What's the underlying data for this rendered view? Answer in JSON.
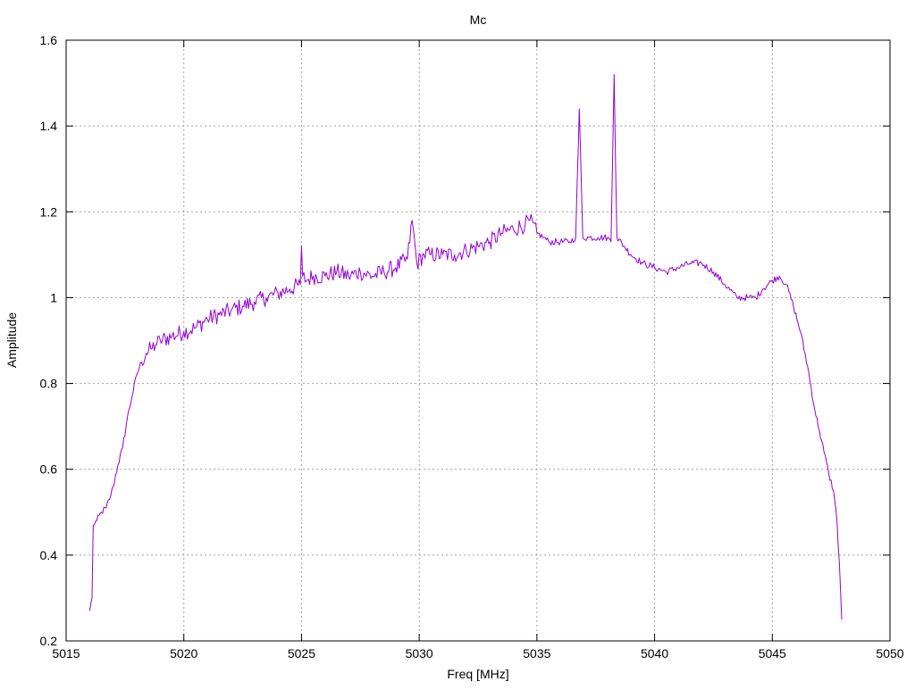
{
  "chart_data": {
    "type": "line",
    "title": "Mc",
    "xlabel": "Freq [MHz]",
    "ylabel": "Amplitude",
    "xlim": [
      5015,
      5050
    ],
    "ylim": [
      0.2,
      1.6
    ],
    "x_ticks": [
      5015,
      5020,
      5025,
      5030,
      5035,
      5040,
      5045,
      5050
    ],
    "x_tick_labels": [
      "5015",
      "5020",
      "5025",
      "5030",
      "5035",
      "5040",
      "5045",
      "5050"
    ],
    "y_ticks": [
      0.2,
      0.4,
      0.6,
      0.8,
      1.0,
      1.2,
      1.4,
      1.6
    ],
    "y_tick_labels": [
      "0.2",
      "0.4",
      "0.6",
      "0.8",
      "1",
      "1.2",
      "1.4",
      "1.6"
    ],
    "grid": true,
    "grid_style": "dotted",
    "series": [
      {
        "color": "#9400d3",
        "x": [
          5016.0,
          5016.1,
          5016.15,
          5016.3,
          5016.5,
          5016.7,
          5016.9,
          5017.0,
          5017.2,
          5017.4,
          5017.6,
          5017.8,
          5018.0,
          5018.2,
          5018.4,
          5018.6,
          5018.8,
          5019.0,
          5019.5,
          5020.0,
          5020.5,
          5021.0,
          5021.5,
          5022.0,
          5022.5,
          5023.0,
          5023.5,
          5024.0,
          5024.5,
          5024.95,
          5025.0,
          5025.05,
          5025.2,
          5025.5,
          5026.0,
          5026.5,
          5027.0,
          5027.5,
          5028.0,
          5028.5,
          5029.0,
          5029.5,
          5029.7,
          5029.9,
          5030.2,
          5030.5,
          5031.0,
          5031.5,
          5032.0,
          5032.5,
          5033.0,
          5033.5,
          5034.0,
          5034.5,
          5034.7,
          5035.0,
          5035.3,
          5035.5,
          5036.0,
          5036.4,
          5036.65,
          5036.8,
          5036.95,
          5037.2,
          5037.6,
          5038.0,
          5038.15,
          5038.28,
          5038.4,
          5038.7,
          5039.0,
          5039.5,
          5040.0,
          5040.5,
          5041.0,
          5041.5,
          5042.0,
          5042.5,
          5043.0,
          5043.5,
          5044.0,
          5044.3,
          5044.6,
          5045.0,
          5045.3,
          5045.6,
          5045.9,
          5046.2,
          5046.5,
          5046.8,
          5047.0,
          5047.2,
          5047.4,
          5047.6,
          5047.75,
          5047.85,
          5047.95
        ],
        "y": [
          0.27,
          0.3,
          0.47,
          0.48,
          0.5,
          0.51,
          0.54,
          0.56,
          0.61,
          0.65,
          0.72,
          0.77,
          0.82,
          0.85,
          0.87,
          0.88,
          0.89,
          0.9,
          0.91,
          0.92,
          0.93,
          0.95,
          0.96,
          0.97,
          0.98,
          0.99,
          1.0,
          1.01,
          1.02,
          1.03,
          1.12,
          1.05,
          1.04,
          1.05,
          1.05,
          1.06,
          1.05,
          1.06,
          1.05,
          1.06,
          1.07,
          1.09,
          1.18,
          1.08,
          1.1,
          1.1,
          1.1,
          1.1,
          1.11,
          1.12,
          1.13,
          1.15,
          1.16,
          1.17,
          1.18,
          1.15,
          1.14,
          1.13,
          1.13,
          1.13,
          1.14,
          1.44,
          1.14,
          1.14,
          1.14,
          1.14,
          1.13,
          1.52,
          1.14,
          1.12,
          1.1,
          1.08,
          1.07,
          1.06,
          1.07,
          1.08,
          1.08,
          1.06,
          1.03,
          1.0,
          1.0,
          1.0,
          1.02,
          1.04,
          1.05,
          1.03,
          0.98,
          0.92,
          0.84,
          0.74,
          0.69,
          0.64,
          0.59,
          0.55,
          0.48,
          0.38,
          0.25
        ]
      }
    ]
  }
}
